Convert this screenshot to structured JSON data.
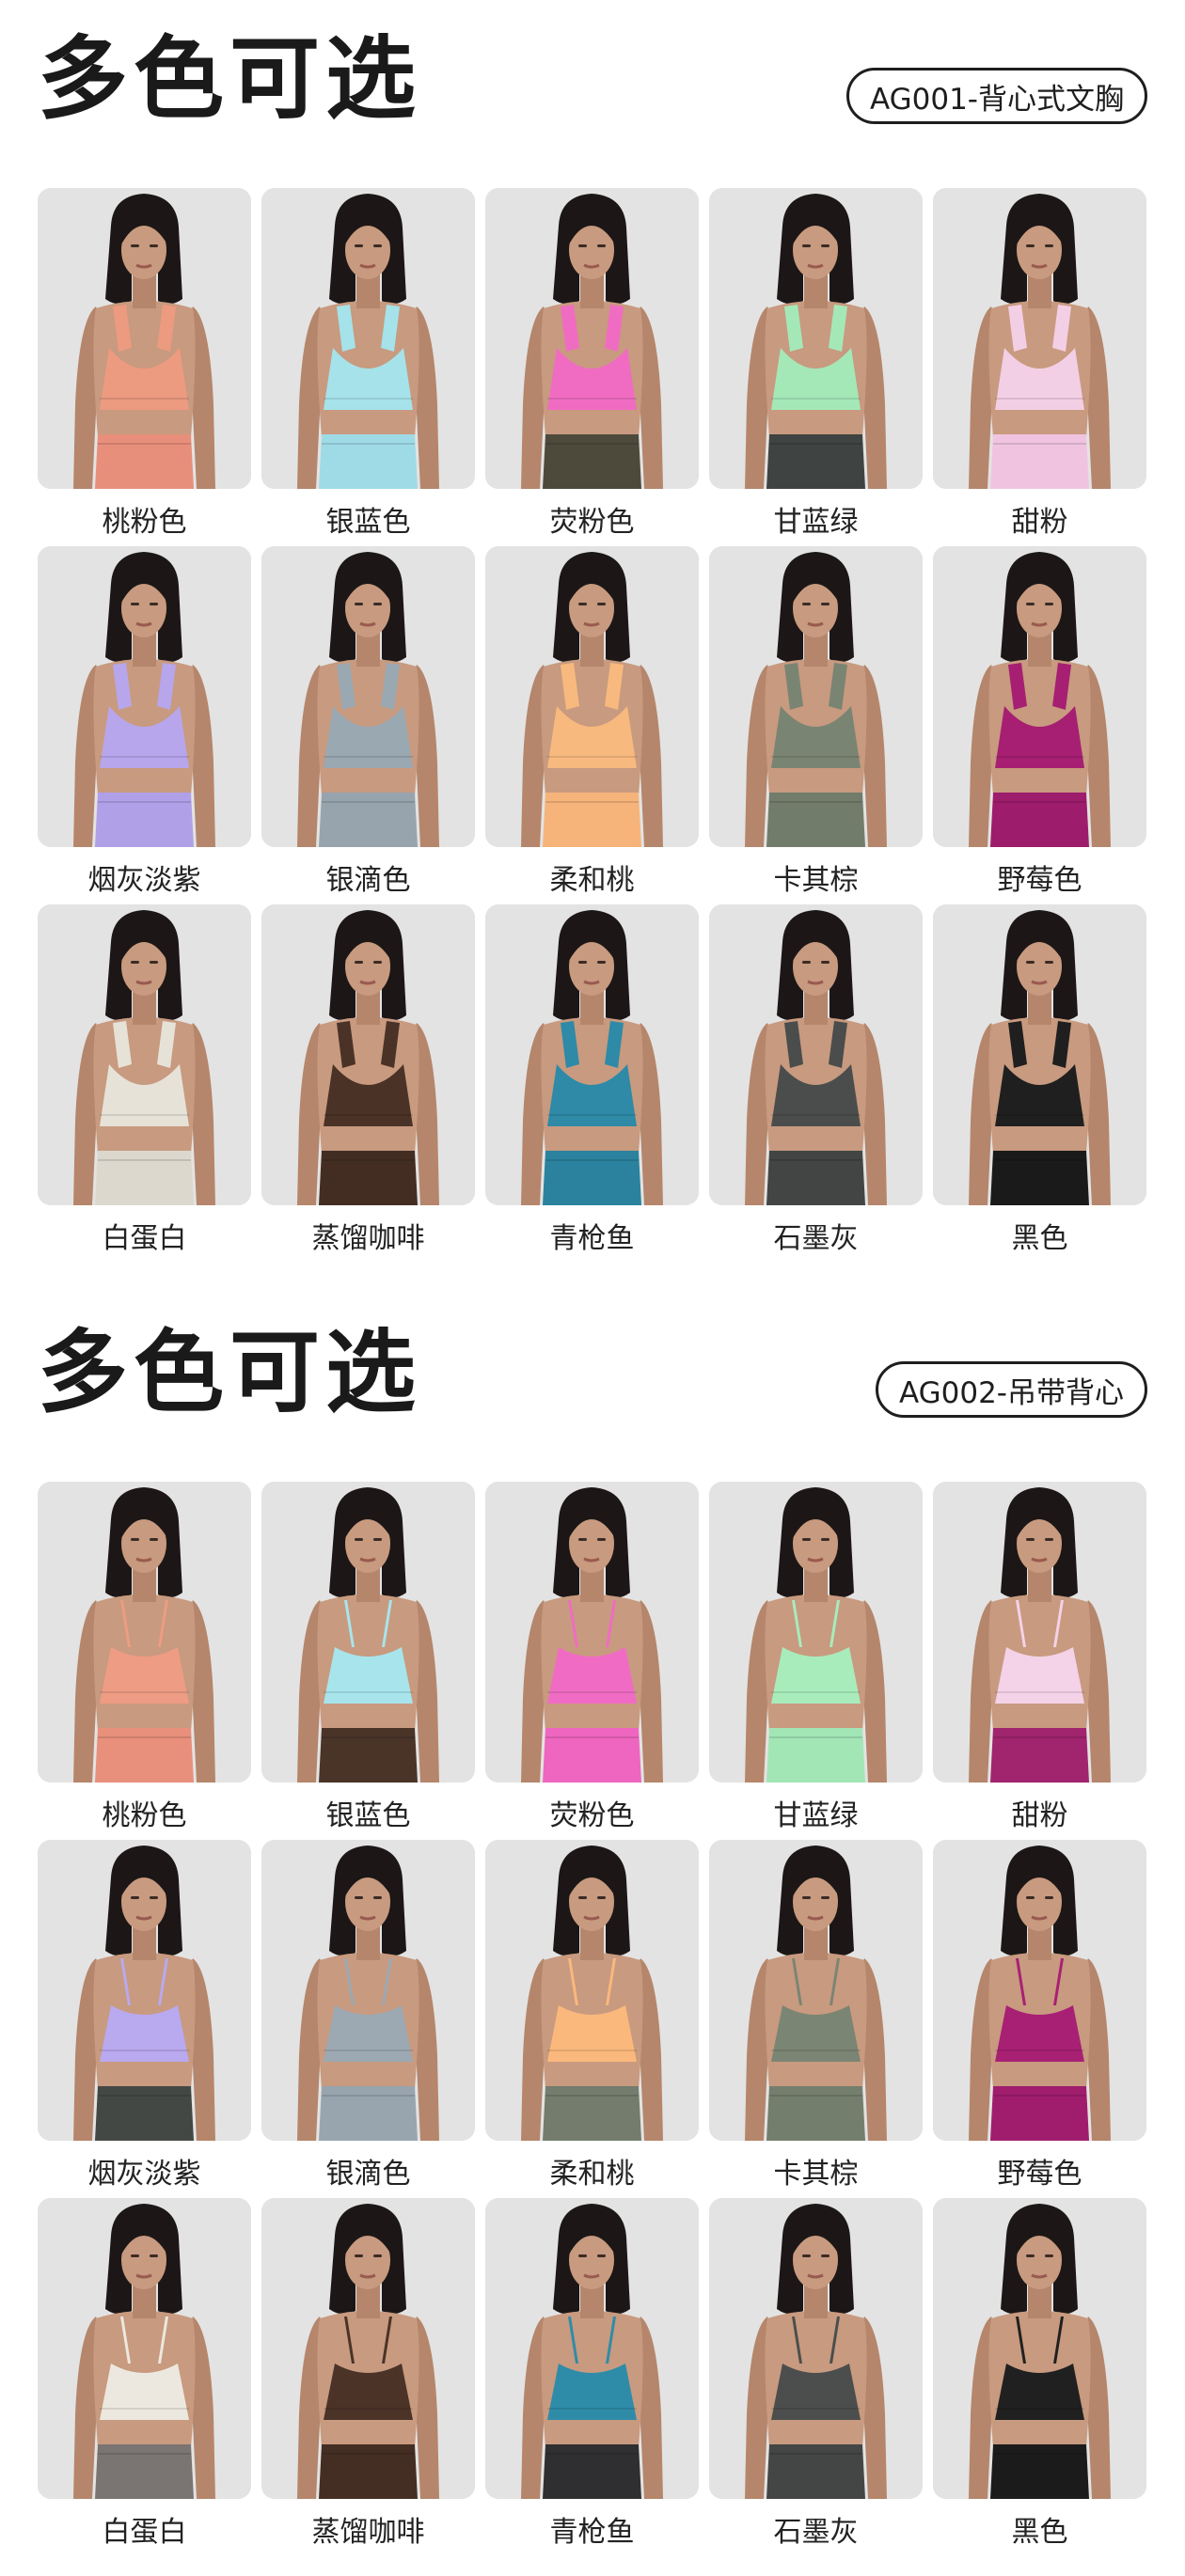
{
  "sections": [
    {
      "title": "多色可选",
      "code": "AG001-背心式文胸",
      "style": "tank",
      "items": [
        {
          "label": "桃粉色",
          "top": "#ec9a80",
          "bottom": "#e88f7b"
        },
        {
          "label": "银蓝色",
          "top": "#a6e2ea",
          "bottom": "#9fdbe6"
        },
        {
          "label": "荧粉色",
          "top": "#f06cc2",
          "bottom": "#4d4a3c"
        },
        {
          "label": "甘蓝绿",
          "top": "#a5e8b8",
          "bottom": "#3f4342"
        },
        {
          "label": "甜粉",
          "top": "#f3cfe5",
          "bottom": "#f0c4e0"
        },
        {
          "label": "烟灰淡紫",
          "top": "#b7a6eb",
          "bottom": "#b0a0e8"
        },
        {
          "label": "银滴色",
          "top": "#9aa8b2",
          "bottom": "#97a4ae"
        },
        {
          "label": "柔和桃",
          "top": "#f8b97f",
          "bottom": "#f6b47a"
        },
        {
          "label": "卡其棕",
          "top": "#7a8473",
          "bottom": "#727c6b"
        },
        {
          "label": "野莓色",
          "top": "#a61f72",
          "bottom": "#9e1c6c"
        },
        {
          "label": "白蛋白",
          "top": "#e6e2d8",
          "bottom": "#dcd8cd"
        },
        {
          "label": "蒸馏咖啡",
          "top": "#4a3226",
          "bottom": "#432d22"
        },
        {
          "label": "青枪鱼",
          "top": "#2e8aa6",
          "bottom": "#2a829e"
        },
        {
          "label": "石墨灰",
          "top": "#4a4d4c",
          "bottom": "#424544"
        },
        {
          "label": "黑色",
          "top": "#1f1f1f",
          "bottom": "#1a1a1a"
        }
      ]
    },
    {
      "title": "多色可选",
      "code": "AG002-吊带背心",
      "style": "cami",
      "items": [
        {
          "label": "桃粉色",
          "top": "#ee9c84",
          "bottom": "#e8907c"
        },
        {
          "label": "银蓝色",
          "top": "#a8e4ec",
          "bottom": "#4a3428"
        },
        {
          "label": "荧粉色",
          "top": "#f06cc4",
          "bottom": "#ee66c0"
        },
        {
          "label": "甘蓝绿",
          "top": "#a8ecbc",
          "bottom": "#a2e6b6"
        },
        {
          "label": "甜粉",
          "top": "#f4d2e8",
          "bottom": "#a0246e"
        },
        {
          "label": "烟灰淡紫",
          "top": "#b9a9ee",
          "bottom": "#434845"
        },
        {
          "label": "银滴色",
          "top": "#9ca9b3",
          "bottom": "#98a5af"
        },
        {
          "label": "柔和桃",
          "top": "#fab87c",
          "bottom": "#737c6d"
        },
        {
          "label": "卡其棕",
          "top": "#7b8574",
          "bottom": "#747e6d"
        },
        {
          "label": "野莓色",
          "top": "#a82074",
          "bottom": "#a01d6e"
        },
        {
          "label": "白蛋白",
          "top": "#ece8df",
          "bottom": "#7a7473"
        },
        {
          "label": "蒸馏咖啡",
          "top": "#4b3327",
          "bottom": "#442e23"
        },
        {
          "label": "青枪鱼",
          "top": "#2f8ca8",
          "bottom": "#2f2f31"
        },
        {
          "label": "石墨灰",
          "top": "#4b4e4d",
          "bottom": "#434645"
        },
        {
          "label": "黑色",
          "top": "#202020",
          "bottom": "#1b1b1b"
        }
      ]
    }
  ],
  "palette": {
    "skin": "#c89a7f",
    "skin_shadow": "#b5866b",
    "hair": "#1c1716",
    "backdrop": "#e3e3e3"
  }
}
